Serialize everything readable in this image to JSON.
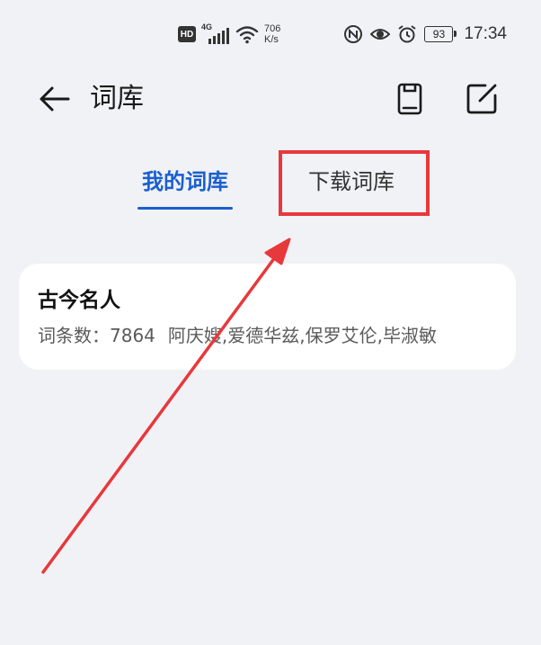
{
  "status_bar": {
    "hd": "HD",
    "network_gen": "4G",
    "speed_value": "706",
    "speed_unit": "K/s",
    "battery": "93",
    "time": "17:34",
    "icons": [
      "signal-icon",
      "wifi-icon",
      "nfc-icon",
      "eye-icon",
      "alarm-icon",
      "battery-icon"
    ]
  },
  "header": {
    "title": "词库",
    "back_icon": "back-arrow-icon",
    "import_icon": "phone-import-icon",
    "edit_icon": "edit-icon"
  },
  "tabs": [
    {
      "label": "我的词库",
      "active": true
    },
    {
      "label": "下载词库",
      "active": false
    }
  ],
  "lexicons": [
    {
      "name": "古今名人",
      "count_label": "词条数：",
      "count": "7864",
      "preview": "阿庆嫂,爱德华兹,保罗艾伦,毕淑敏"
    }
  ],
  "colors": {
    "accent": "#1a5fd0",
    "annotation": "#e8383b",
    "background": "#f1f2f6",
    "card": "#ffffff"
  }
}
